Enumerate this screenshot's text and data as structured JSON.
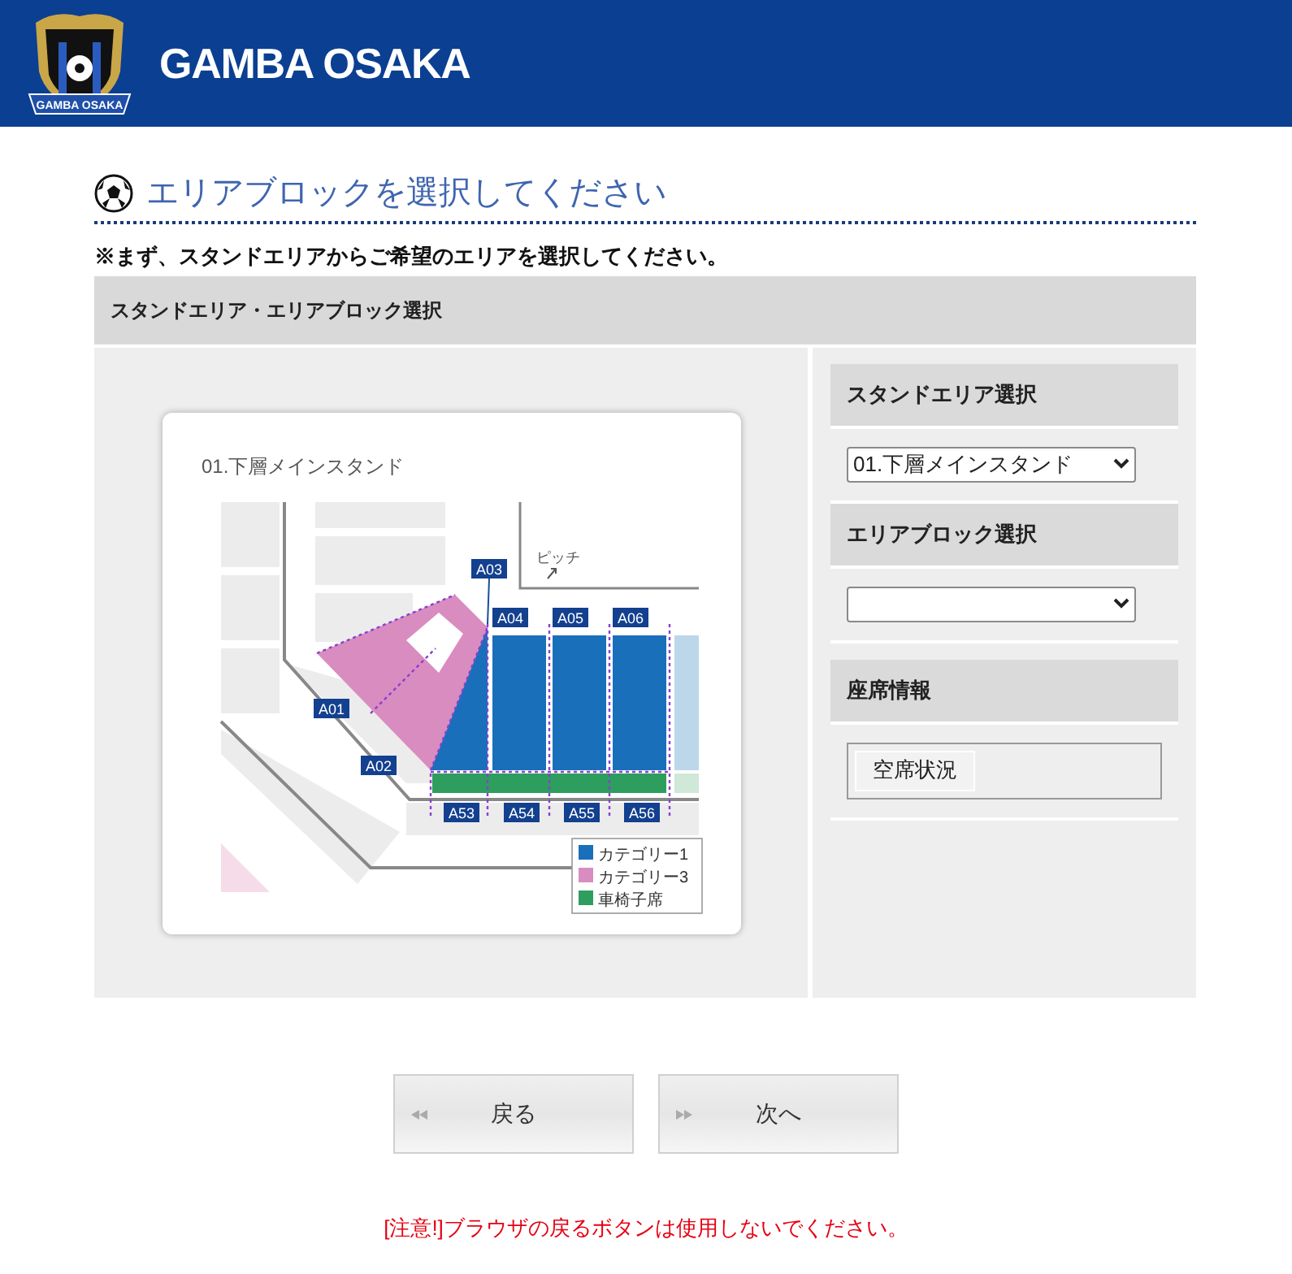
{
  "header": {
    "logo_text": "GAMBA OSAKA",
    "title": "GAMBA OSAKA"
  },
  "page_title": "エリアブロックを選択してください",
  "instruction": "※まず、スタンドエリアからご希望のエリアを選択してください。",
  "panel": {
    "title": "スタンドエリア・エリアブロック選択",
    "map": {
      "title": "01.下層メインスタンド",
      "pitch_label": "ピッチ",
      "blocks": [
        {
          "label": "A03"
        },
        {
          "label": "A04"
        },
        {
          "label": "A05"
        },
        {
          "label": "A06"
        },
        {
          "label": "A01"
        },
        {
          "label": "A02"
        },
        {
          "label": "A53"
        },
        {
          "label": "A54"
        },
        {
          "label": "A55"
        },
        {
          "label": "A56"
        }
      ],
      "legend": [
        {
          "label": "カテゴリー1",
          "color": "#1a6fba"
        },
        {
          "label": "カテゴリー3",
          "color": "#d98cbf"
        },
        {
          "label": "車椅子席",
          "color": "#2e9e5e"
        }
      ]
    },
    "sections": [
      {
        "kind": "select",
        "title": "スタンドエリア選択",
        "value": "01.下層メインスタンド"
      },
      {
        "kind": "select",
        "title": "エリアブロック選択"
      },
      {
        "kind": "info",
        "title": "座席情報",
        "button": "空席状況"
      }
    ]
  },
  "nav_buttons": [
    {
      "kind": "back",
      "label": "戻る"
    },
    {
      "kind": "next",
      "label": "次へ"
    }
  ],
  "warning": "[注意!]ブラウザの戻るボタンは使用しないでください。"
}
